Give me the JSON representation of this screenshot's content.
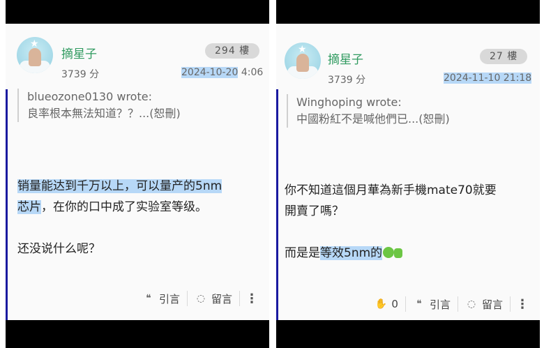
{
  "left_post": {
    "username": "摘星子",
    "points": "3739 分",
    "floor": "294 樓",
    "timestamp_date": "2024-10-20",
    "timestamp_time": "4:06",
    "quote_author": "blueozone0130 wrote:",
    "quote_text": "良率根本無法知道？？...(恕刪)",
    "body_line1_hl": "销量能达到千万以上，可以量产的5nm",
    "body_line2_hl": "芯片",
    "body_line2_rest": "，在你的口中成了实验室等级。",
    "body_line3": "还没说什么呢？",
    "actions": {
      "quote_label": "引言",
      "reply_label": "留言"
    }
  },
  "right_post": {
    "username": "摘星子",
    "points": "3739 分",
    "floor": "27 樓",
    "timestamp": "2024-11-10 21:18",
    "quote_author": "Winghoping wrote:",
    "quote_text": "中國粉紅不是喊他們已...(恕刪)",
    "body_line1": "你不知道這個月華為新手機mate70就要",
    "body_line2": "開賣了嗎？",
    "body_line3_prefix": "而是是",
    "body_line3_hl": "等效5nm的",
    "actions": {
      "like_count": "0",
      "quote_label": "引言",
      "reply_label": "留言"
    }
  },
  "icons": [
    "avatar-star",
    "like-hand-icon",
    "quote-bubble-icon",
    "reply-bubble-icon",
    "more-vertical-icon"
  ],
  "colors": {
    "username": "#2f9a5f",
    "highlight": "#b7d8f7",
    "accent_bar": "#1a1aa0"
  }
}
